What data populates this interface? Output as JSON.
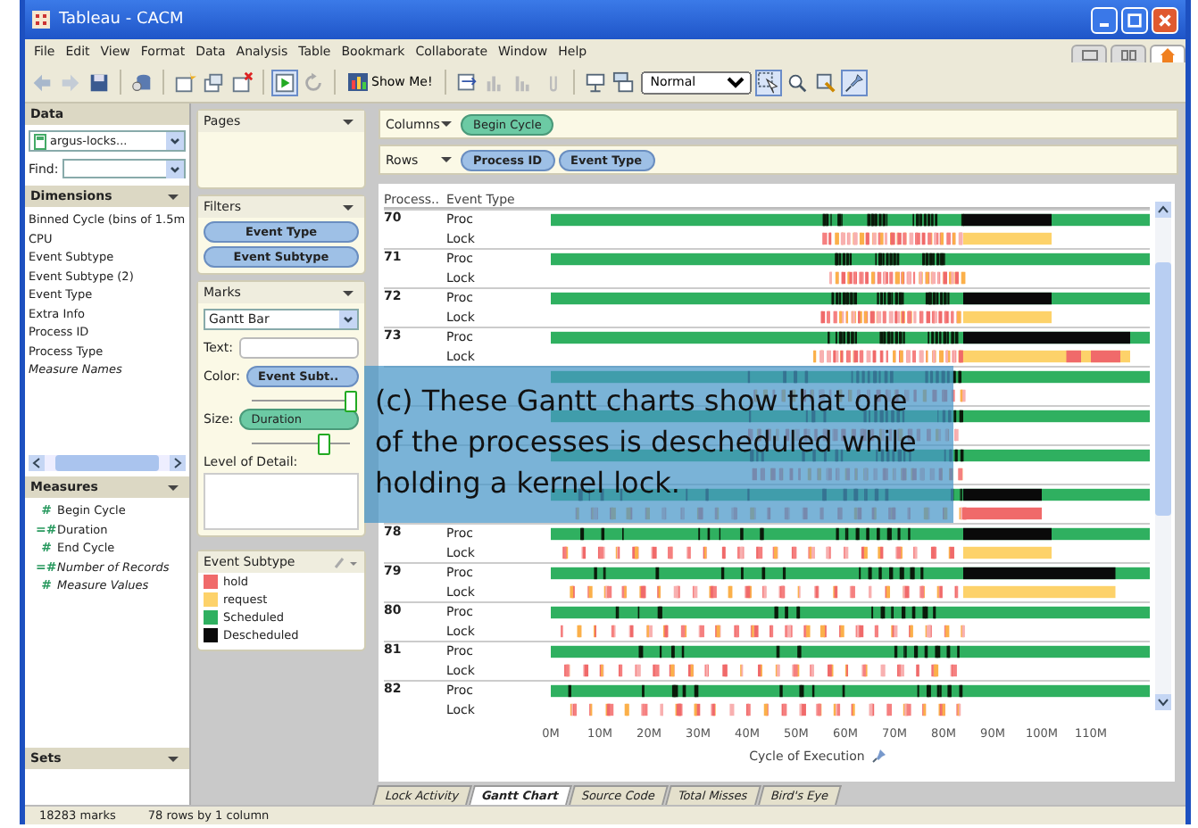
{
  "window": {
    "title": "Tableau - CACM"
  },
  "menu": [
    "File",
    "Edit",
    "View",
    "Format",
    "Data",
    "Analysis",
    "Table",
    "Bookmark",
    "Collaborate",
    "Window",
    "Help"
  ],
  "toolbar": {
    "show_me": "Show Me!",
    "fit": "Normal"
  },
  "data_panel": {
    "title": "Data",
    "source": "argus-locks...",
    "find_label": "Find:"
  },
  "dimensions": {
    "title": "Dimensions",
    "items": [
      {
        "label": "Binned Cycle (bins of 1.5m",
        "kind": "field"
      },
      {
        "label": "CPU",
        "kind": "field"
      },
      {
        "label": "Event Subtype",
        "kind": "field"
      },
      {
        "label": "Event Subtype (2)",
        "kind": "field"
      },
      {
        "label": "Event Type",
        "kind": "field"
      },
      {
        "label": "Extra Info",
        "kind": "field"
      },
      {
        "label": "Process ID",
        "kind": "field"
      },
      {
        "label": "Process Type",
        "kind": "field"
      },
      {
        "label": "Measure Names",
        "kind": "generated"
      }
    ]
  },
  "measures": {
    "title": "Measures",
    "items": [
      {
        "symbol": "#",
        "label": "Begin Cycle",
        "kind": "field"
      },
      {
        "symbol": "=#",
        "label": "Duration",
        "kind": "calculated"
      },
      {
        "symbol": "#",
        "label": "End Cycle",
        "kind": "field"
      },
      {
        "symbol": "=#",
        "label": "Number of Records",
        "kind": "generated"
      },
      {
        "symbol": "#",
        "label": "Measure Values",
        "kind": "generated"
      }
    ]
  },
  "sets": {
    "title": "Sets"
  },
  "pages": {
    "title": "Pages"
  },
  "filters": {
    "title": "Filters",
    "pills": [
      "Event Type",
      "Event Subtype"
    ]
  },
  "marks": {
    "title": "Marks",
    "mark_type": "Gantt Bar",
    "text_label": "Text:",
    "color_label": "Color:",
    "color_pill": "Event Subt..",
    "color_slider": {
      "level": 1.0
    },
    "size_label": "Size:",
    "size_pill": "Duration",
    "size_slider": {
      "level": 0.72
    },
    "detail_label": "Level of Detail:"
  },
  "legend": {
    "title": "Event Subtype",
    "items": [
      {
        "label": "hold",
        "color": "#f06a6a"
      },
      {
        "label": "request",
        "color": "#fdd26a"
      },
      {
        "label": "Scheduled",
        "color": "#2fb060"
      },
      {
        "label": "Descheduled",
        "color": "#0a0a0a"
      }
    ]
  },
  "shelves": [
    {
      "label": "Columns",
      "pills": [
        {
          "text": "Begin Cycle",
          "kind": "measure"
        }
      ]
    },
    {
      "label": "Rows",
      "pills": [
        {
          "text": "Process ID",
          "kind": "dimension"
        },
        {
          "text": "Event Type",
          "kind": "dimension"
        }
      ]
    }
  ],
  "chart": {
    "headers": [
      "Process..",
      "Event Type"
    ],
    "rows": [
      {
        "id": "70",
        "types": [
          "Proc",
          "Lock"
        ]
      },
      {
        "id": "71",
        "types": [
          "Proc",
          "Lock"
        ]
      },
      {
        "id": "72",
        "types": [
          "Proc",
          "Lock"
        ]
      },
      {
        "id": "73",
        "types": [
          "Proc",
          "Lock"
        ]
      },
      {
        "types": []
      },
      {
        "types": []
      },
      {
        "types": []
      },
      {
        "types": []
      },
      {
        "id": "78",
        "types": [
          "Proc",
          "Lock"
        ]
      },
      {
        "id": "79",
        "types": [
          "Proc",
          "Lock"
        ]
      },
      {
        "id": "80",
        "types": [
          "Proc",
          "Lock"
        ]
      },
      {
        "id": "81",
        "types": [
          "Proc",
          "Lock"
        ]
      },
      {
        "id": "82",
        "types": [
          "Proc",
          "Lock"
        ]
      }
    ],
    "axis_ticks": [
      "0M",
      "10M",
      "20M",
      "30M",
      "40M",
      "50M",
      "60M",
      "70M",
      "80M",
      "90M",
      "100M",
      "110M"
    ],
    "axis_title": "Cycle of Execution"
  },
  "caption": "(c) These Gantt charts show that one of the processes is descheduled while holding a kernel lock.",
  "sheet_tabs": [
    {
      "label": "Lock Activity",
      "selected": false
    },
    {
      "label": "Gantt Chart",
      "selected": true
    },
    {
      "label": "Source Code",
      "selected": false
    },
    {
      "label": "Total Misses",
      "selected": false
    },
    {
      "label": "Bird's Eye",
      "selected": false
    }
  ],
  "status_bar": [
    "18283 marks",
    "78 rows by 1 column"
  ]
}
